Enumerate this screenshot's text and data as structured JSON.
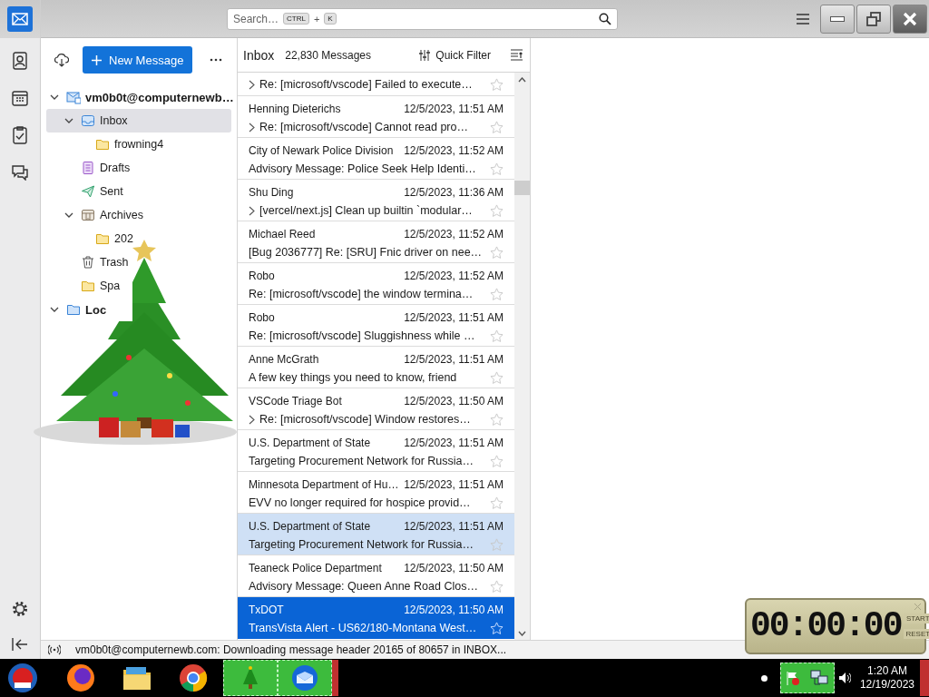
{
  "search": {
    "placeholder": "Search…",
    "shortcut": [
      "CTRL",
      "K"
    ],
    "joiner": "+"
  },
  "folder_pane": {
    "new_message": "New Message",
    "folders": [
      {
        "name": "vm0b0t@computernewb…",
        "kind": "account",
        "expanded": true,
        "selected": false,
        "children": [
          {
            "name": "Inbox",
            "kind": "inbox",
            "expanded": true,
            "selected": true,
            "children": [
              {
                "name": "frowning4",
                "kind": "folder",
                "selected": false
              }
            ]
          },
          {
            "name": "Drafts",
            "kind": "drafts",
            "selected": false
          },
          {
            "name": "Sent",
            "kind": "sent",
            "selected": false
          },
          {
            "name": "Archives",
            "kind": "archives",
            "expanded": true,
            "selected": false,
            "children": [
              {
                "name": "202",
                "kind": "folder",
                "selected": false
              }
            ]
          },
          {
            "name": "Trash",
            "kind": "trash",
            "selected": false
          },
          {
            "name": "Spa",
            "kind": "folder",
            "selected": false
          }
        ]
      },
      {
        "name": "Loc",
        "kind": "local",
        "expanded": true,
        "selected": false
      }
    ]
  },
  "message_list": {
    "title": "Inbox",
    "count": "22,830 Messages",
    "quick_filter": "Quick Filter",
    "messages": [
      {
        "subject": "Re: [microsoft/vscode] Failed to execute…",
        "thread": true,
        "starred": false,
        "selected": false,
        "hovered": false
      },
      {
        "sender": "Henning Dieterichs",
        "date": "12/5/2023, 11:51 AM",
        "subject": "Re: [microsoft/vscode] Cannot read pro…",
        "thread": true,
        "starred": false,
        "selected": false,
        "hovered": false
      },
      {
        "sender": "City of Newark Police Division",
        "date": "12/5/2023, 11:52 AM",
        "subject": "Advisory Message: Police Seek Help Identi…",
        "thread": false,
        "starred": false,
        "selected": false,
        "hovered": false
      },
      {
        "sender": "Shu Ding",
        "date": "12/5/2023, 11:36 AM",
        "subject": "[vercel/next.js] Clean up builtin `modular…",
        "thread": true,
        "starred": false,
        "selected": false,
        "hovered": false
      },
      {
        "sender": "Michael Reed",
        "date": "12/5/2023, 11:52 AM",
        "subject": "[Bug 2036777] Re: [SRU] Fnic driver on nee…",
        "thread": false,
        "starred": false,
        "selected": false,
        "hovered": false
      },
      {
        "sender": "Robo",
        "date": "12/5/2023, 11:52 AM",
        "subject": "Re: [microsoft/vscode] the window termina…",
        "thread": false,
        "starred": false,
        "selected": false,
        "hovered": false
      },
      {
        "sender": "Robo",
        "date": "12/5/2023, 11:51 AM",
        "subject": "Re: [microsoft/vscode] Sluggishness while …",
        "thread": false,
        "starred": false,
        "selected": false,
        "hovered": false
      },
      {
        "sender": "Anne McGrath",
        "date": "12/5/2023, 11:51 AM",
        "subject": "A few key things you need to know, friend",
        "thread": false,
        "starred": false,
        "selected": false,
        "hovered": false
      },
      {
        "sender": "VSCode Triage Bot",
        "date": "12/5/2023, 11:50 AM",
        "subject": "Re: [microsoft/vscode] Window restores…",
        "thread": true,
        "starred": false,
        "selected": false,
        "hovered": false
      },
      {
        "sender": "U.S. Department of State",
        "date": "12/5/2023, 11:51 AM",
        "subject": "Targeting Procurement Network for Russia…",
        "thread": false,
        "starred": false,
        "selected": false,
        "hovered": false
      },
      {
        "sender": "Minnesota Department of Hu…",
        "date": "12/5/2023, 11:51 AM",
        "subject": "EVV no longer required for hospice provid…",
        "thread": false,
        "starred": false,
        "selected": false,
        "hovered": false
      },
      {
        "sender": "U.S. Department of State",
        "date": "12/5/2023, 11:51 AM",
        "subject": "Targeting Procurement Network for Russia…",
        "thread": false,
        "starred": false,
        "selected": false,
        "hovered": true
      },
      {
        "sender": "Teaneck Police Department",
        "date": "12/5/2023, 11:50 AM",
        "subject": "Advisory Message: Queen Anne Road Clos…",
        "thread": false,
        "starred": false,
        "selected": false,
        "hovered": false
      },
      {
        "sender": "TxDOT",
        "date": "12/5/2023, 11:50 AM",
        "subject": "TransVista Alert - US62/180-Montana West…",
        "thread": false,
        "starred": false,
        "selected": true,
        "hovered": false
      }
    ]
  },
  "status_bar": {
    "text": "vm0b0t@computernewb.com: Downloading message header 20165 of 80657 in INBOX..."
  },
  "timer_gadget": {
    "display": "00:00:00",
    "buttons": [
      "START",
      "RESET"
    ]
  },
  "taskbar": {
    "time": "1:20 AM",
    "date": "12/19/2023"
  }
}
